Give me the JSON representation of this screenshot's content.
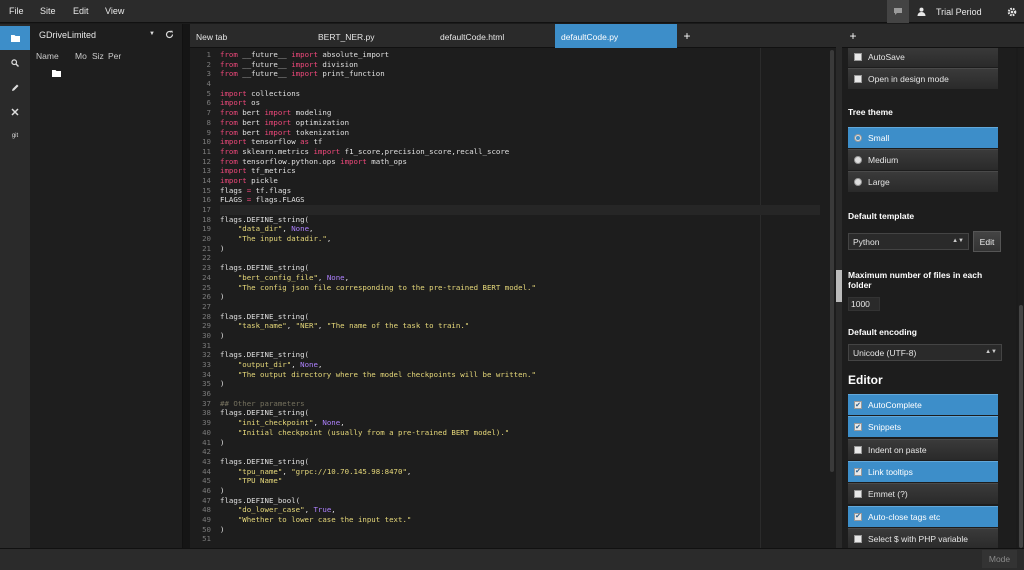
{
  "menubar": {
    "items": [
      "File",
      "Site",
      "Edit",
      "View"
    ],
    "account_label": "Trial Period",
    "icons": {
      "chat": "chat-icon",
      "user": "user-icon",
      "settings": "gear-icon"
    }
  },
  "rail": {
    "icons": [
      "folder-icon",
      "search-icon",
      "pencil-icon",
      "tools-icon",
      "git-icon"
    ],
    "git_label": "git"
  },
  "file_panel": {
    "site_name": "GDriveLimited",
    "columns": [
      "Name",
      "Mo",
      "Siz",
      "Per"
    ]
  },
  "tabs": [
    {
      "label": "New tab",
      "active": false
    },
    {
      "label": "BERT_NER.py",
      "active": false
    },
    {
      "label": "defaultCode.html",
      "active": false
    },
    {
      "label": "defaultCode.py",
      "active": true
    }
  ],
  "tab_add_label": "+",
  "editor": {
    "active_line": 17,
    "lines": [
      [
        [
          "kw",
          "from"
        ],
        [
          "t",
          " __future__ "
        ],
        [
          "kw",
          "import"
        ],
        [
          "t",
          " absolute_import"
        ]
      ],
      [
        [
          "kw",
          "from"
        ],
        [
          "t",
          " __future__ "
        ],
        [
          "kw",
          "import"
        ],
        [
          "t",
          " division"
        ]
      ],
      [
        [
          "kw",
          "from"
        ],
        [
          "t",
          " __future__ "
        ],
        [
          "kw",
          "import"
        ],
        [
          "t",
          " print_function"
        ]
      ],
      [],
      [
        [
          "kw",
          "import"
        ],
        [
          "t",
          " collections"
        ]
      ],
      [
        [
          "kw",
          "import"
        ],
        [
          "t",
          " os"
        ]
      ],
      [
        [
          "kw",
          "from"
        ],
        [
          "t",
          " bert "
        ],
        [
          "kw",
          "import"
        ],
        [
          "t",
          " modeling"
        ]
      ],
      [
        [
          "kw",
          "from"
        ],
        [
          "t",
          " bert "
        ],
        [
          "kw",
          "import"
        ],
        [
          "t",
          " optimization"
        ]
      ],
      [
        [
          "kw",
          "from"
        ],
        [
          "t",
          " bert "
        ],
        [
          "kw",
          "import"
        ],
        [
          "t",
          " tokenization"
        ]
      ],
      [
        [
          "kw",
          "import"
        ],
        [
          "t",
          " tensorflow "
        ],
        [
          "kw",
          "as"
        ],
        [
          "t",
          " tf"
        ]
      ],
      [
        [
          "kw",
          "from"
        ],
        [
          "t",
          " sklearn.metrics "
        ],
        [
          "kw",
          "import"
        ],
        [
          "t",
          " f1_score,precision_score,recall_score"
        ]
      ],
      [
        [
          "kw",
          "from"
        ],
        [
          "t",
          " tensorflow.python.ops "
        ],
        [
          "kw",
          "import"
        ],
        [
          "t",
          " math_ops"
        ]
      ],
      [
        [
          "kw",
          "import"
        ],
        [
          "t",
          " tf_metrics"
        ]
      ],
      [
        [
          "kw",
          "import"
        ],
        [
          "t",
          " pickle"
        ]
      ],
      [
        [
          "t",
          "flags "
        ],
        [
          "kw",
          "="
        ],
        [
          "t",
          " tf.flags"
        ]
      ],
      [
        [
          "t",
          "FLAGS "
        ],
        [
          "kw",
          "="
        ],
        [
          "t",
          " flags.FLAGS"
        ]
      ],
      [],
      [
        [
          "t",
          "flags.DEFINE_string("
        ]
      ],
      [
        [
          "t",
          "    "
        ],
        [
          "str",
          "\"data_dir\""
        ],
        [
          "t",
          ", "
        ],
        [
          "num",
          "None"
        ],
        [
          "t",
          ","
        ]
      ],
      [
        [
          "t",
          "    "
        ],
        [
          "str",
          "\"The input datadir.\""
        ],
        [
          "t",
          ","
        ]
      ],
      [
        [
          "t",
          ")"
        ]
      ],
      [],
      [
        [
          "t",
          "flags.DEFINE_string("
        ]
      ],
      [
        [
          "t",
          "    "
        ],
        [
          "str",
          "\"bert_config_file\""
        ],
        [
          "t",
          ", "
        ],
        [
          "num",
          "None"
        ],
        [
          "t",
          ","
        ]
      ],
      [
        [
          "t",
          "    "
        ],
        [
          "str",
          "\"The config json file corresponding to the pre-trained BERT model.\""
        ]
      ],
      [
        [
          "t",
          ")"
        ]
      ],
      [],
      [
        [
          "t",
          "flags.DEFINE_string("
        ]
      ],
      [
        [
          "t",
          "    "
        ],
        [
          "str",
          "\"task_name\""
        ],
        [
          "t",
          ", "
        ],
        [
          "str",
          "\"NER\""
        ],
        [
          "t",
          ", "
        ],
        [
          "str",
          "\"The name of the task to train.\""
        ]
      ],
      [
        [
          "t",
          ")"
        ]
      ],
      [],
      [
        [
          "t",
          "flags.DEFINE_string("
        ]
      ],
      [
        [
          "t",
          "    "
        ],
        [
          "str",
          "\"output_dir\""
        ],
        [
          "t",
          ", "
        ],
        [
          "num",
          "None"
        ],
        [
          "t",
          ","
        ]
      ],
      [
        [
          "t",
          "    "
        ],
        [
          "str",
          "\"The output directory where the model checkpoints will be written.\""
        ]
      ],
      [
        [
          "t",
          ")"
        ]
      ],
      [],
      [
        [
          "cm",
          "## Other parameters"
        ]
      ],
      [
        [
          "t",
          "flags.DEFINE_string("
        ]
      ],
      [
        [
          "t",
          "    "
        ],
        [
          "str",
          "\"init_checkpoint\""
        ],
        [
          "t",
          ", "
        ],
        [
          "num",
          "None"
        ],
        [
          "t",
          ","
        ]
      ],
      [
        [
          "t",
          "    "
        ],
        [
          "str",
          "\"Initial checkpoint (usually from a pre-trained BERT model).\""
        ]
      ],
      [
        [
          "t",
          ")"
        ]
      ],
      [],
      [
        [
          "t",
          "flags.DEFINE_string("
        ]
      ],
      [
        [
          "t",
          "    "
        ],
        [
          "str",
          "\"tpu_name\""
        ],
        [
          "t",
          ", "
        ],
        [
          "str",
          "\"grpc://10.70.145.98:8470\""
        ],
        [
          "t",
          ","
        ]
      ],
      [
        [
          "t",
          "    "
        ],
        [
          "str",
          "\"TPU Name\""
        ]
      ],
      [
        [
          "t",
          ")"
        ]
      ],
      [
        [
          "t",
          "flags.DEFINE_bool("
        ]
      ],
      [
        [
          "t",
          "    "
        ],
        [
          "str",
          "\"do_lower_case\""
        ],
        [
          "t",
          ", "
        ],
        [
          "num",
          "True"
        ],
        [
          "t",
          ","
        ]
      ],
      [
        [
          "t",
          "    "
        ],
        [
          "str",
          "\"Whether to lower case the input text.\""
        ]
      ],
      [
        [
          "t",
          ")"
        ]
      ],
      []
    ]
  },
  "settings": {
    "autosave_label": "AutoSave",
    "design_mode_label": "Open in design mode",
    "tree_theme_heading": "Tree theme",
    "tree_theme_options": [
      {
        "label": "Small",
        "selected": true
      },
      {
        "label": "Medium",
        "selected": false
      },
      {
        "label": "Large",
        "selected": false
      }
    ],
    "default_template_heading": "Default template",
    "default_template_value": "Python",
    "edit_button_label": "Edit",
    "max_files_heading": "Maximum number of files in each folder",
    "max_files_value": "1000",
    "default_encoding_heading": "Default encoding",
    "default_encoding_value": "Unicode (UTF-8)",
    "editor_heading": "Editor",
    "editor_options": [
      {
        "label": "AutoComplete",
        "checked": true
      },
      {
        "label": "Snippets",
        "checked": true
      },
      {
        "label": "Indent on paste",
        "checked": false
      },
      {
        "label": "Link tooltips",
        "checked": true
      },
      {
        "label": "Emmet (?)",
        "checked": false
      },
      {
        "label": "Auto-close tags etc",
        "checked": true
      },
      {
        "label": "Select $ with PHP variable",
        "checked": false
      }
    ]
  },
  "statusbar": {
    "mode_label": "Mode"
  },
  "colors": {
    "accent": "#3d8ec9",
    "keyword": "#f0487b",
    "string": "#e7d97a",
    "constant": "#ae81ff",
    "comment": "#75715e"
  }
}
